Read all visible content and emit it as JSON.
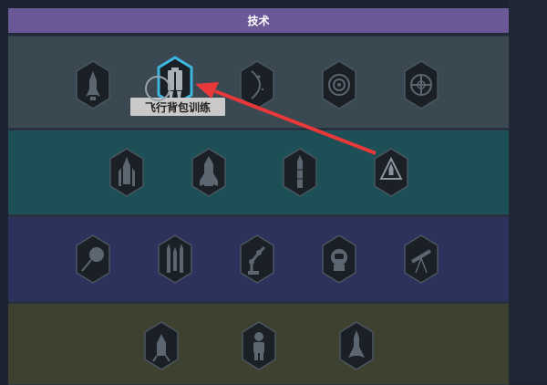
{
  "panel": {
    "title": "技术"
  },
  "tooltip": {
    "text": "飞行背包训练"
  },
  "tiers": [
    {
      "nodes": [
        "rocket-icon",
        "jetpack-icon",
        "orbit-icon",
        "reactor-icon",
        "targeting-icon"
      ],
      "selected": "jetpack-icon"
    },
    {
      "nodes": [
        "rocket-launch-icon",
        "booster-icon",
        "tall-rocket-icon",
        "rocket-badge-icon"
      ]
    },
    {
      "nodes": [
        "satellite-dish-icon",
        "missile-pair-icon",
        "robotic-arm-icon",
        "astronaut-helmet-icon",
        "telescope-icon"
      ]
    },
    {
      "nodes": [
        "landing-capsule-icon",
        "astronaut-icon",
        "spaceship-icon"
      ]
    }
  ],
  "colors": {
    "title_bar": "#6b5896",
    "tier1": "#3a4852",
    "tier2": "#1d4f56",
    "tier3": "#2c325c",
    "tier4": "#3f4130",
    "selected_border": "#3fb6e0",
    "annotation_arrow": "#e8383a"
  }
}
